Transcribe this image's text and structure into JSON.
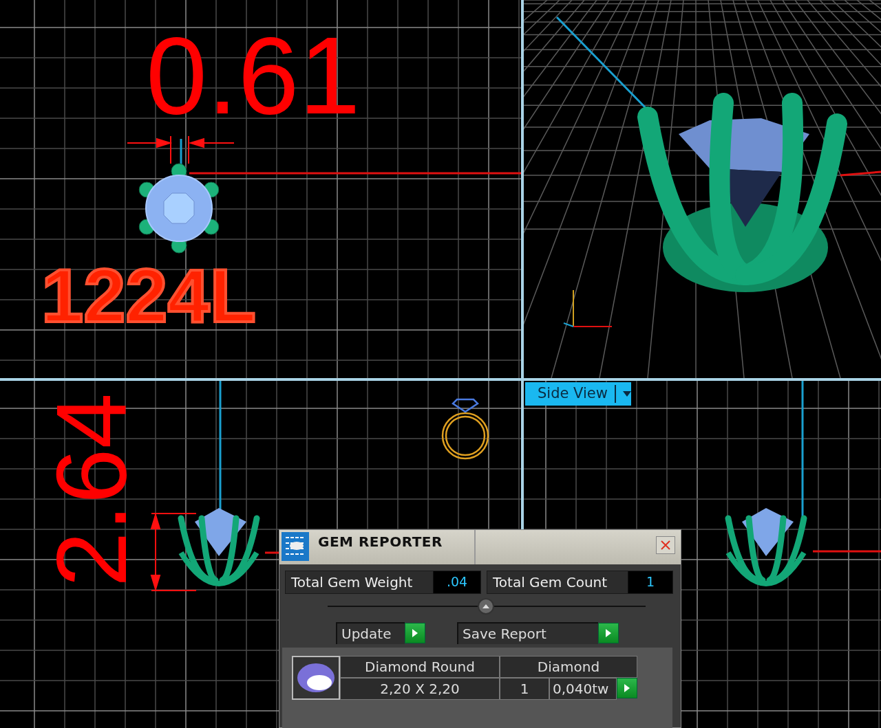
{
  "viewports": [
    {
      "kind": "top",
      "dimension": "0.61",
      "label": "1224L"
    },
    {
      "kind": "perspective"
    },
    {
      "kind": "front",
      "dimension": "2.64"
    },
    {
      "kind": "side",
      "view_menu": "Side View"
    }
  ],
  "gem_reporter": {
    "title": "GEM REPORTER",
    "fields": [
      {
        "label": "Total Gem Weight",
        "value": ".04"
      },
      {
        "label": "Total Gem Count",
        "value": "1"
      }
    ],
    "buttons": [
      "Update",
      "Save Report"
    ],
    "gems": [
      {
        "name": "Diamond Round",
        "material": "Diamond",
        "size": "2,20 X 2,20",
        "count": "1",
        "weight": "0,040tw"
      }
    ]
  }
}
